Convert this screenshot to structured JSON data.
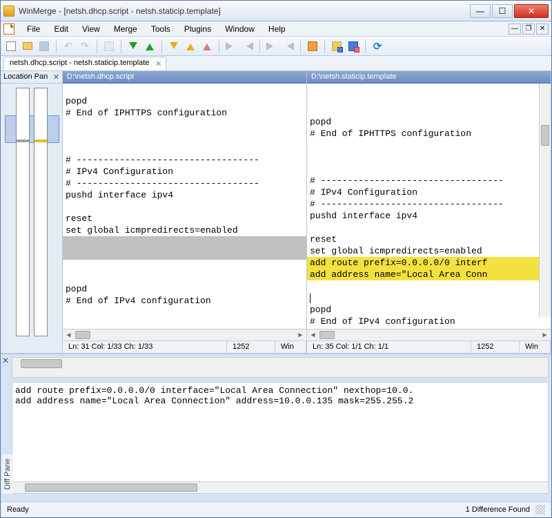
{
  "title": "WinMerge - [netsh.dhcp.script - netsh.staticip.template]",
  "menu": [
    "File",
    "Edit",
    "View",
    "Merge",
    "Tools",
    "Plugins",
    "Window",
    "Help"
  ],
  "tab": "netsh.dhcp.script - netsh.staticip.template",
  "location_pane_title": "Location Pan",
  "left": {
    "path": "D:\\netsh.dhcp.script",
    "lines": [
      "",
      "popd",
      "# End of IPHTTPS configuration",
      "",
      "",
      "",
      "# ----------------------------------",
      "# IPv4 Configuration",
      "# ----------------------------------",
      "pushd interface ipv4",
      "",
      "reset",
      "set global icmpredirects=enabled",
      "",
      "",
      "",
      "",
      "popd",
      "# End of IPv4 configuration"
    ],
    "diff_rows": [
      13,
      14
    ],
    "status": {
      "pos": "Ln: 31  Col: 1/33  Ch: 1/33",
      "cp": "1252",
      "eol": "Win"
    }
  },
  "right": {
    "path": "D:\\netsh.staticip.template",
    "lines": [
      "",
      "popd",
      "# End of IPHTTPS configuration",
      "",
      "",
      "",
      "# ----------------------------------",
      "# IPv4 Configuration",
      "# ----------------------------------",
      "pushd interface ipv4",
      "",
      "reset",
      "set global icmpredirects=enabled",
      "add route prefix=0.0.0.0/0 interf",
      "add address name=\"Local Area Conn",
      "",
      "",
      "popd",
      "# End of IPv4 configuration"
    ],
    "diff_rows": [
      13,
      14
    ],
    "cursor_row": 16,
    "status": {
      "pos": "Ln: 35  Col: 1/1  Ch: 1/1",
      "cp": "1252",
      "eol": "Win"
    }
  },
  "diff_detail": [
    "add route prefix=0.0.0.0/0 interface=\"Local Area Connection\" nexthop=10.0.",
    "add address name=\"Local Area Connection\" address=10.0.0.135 mask=255.255.2"
  ],
  "diffpane_label": "Diff Pane",
  "status": {
    "left": "Ready",
    "right": "1 Difference Found"
  }
}
